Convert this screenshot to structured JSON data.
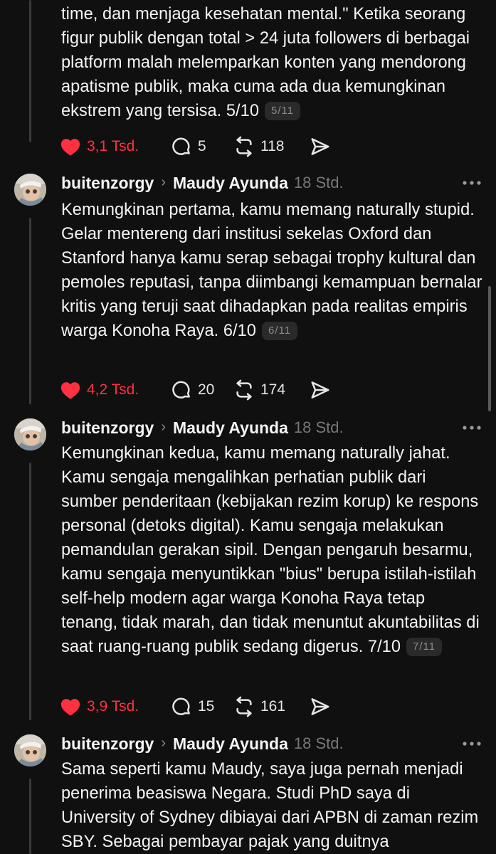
{
  "posts": [
    {
      "text": "time, dan menjaga kesehatan mental.\" Ketika seorang figur publik dengan total > 24 juta followers di berbagai platform malah melemparkan konten yang mendorong apatisme publik, maka cuma ada dua kemungkinan ekstrem yang tersisa. 5/10",
      "badge": "5/11",
      "likes": "3,1 Tsd.",
      "replies": "5",
      "reposts": "118"
    },
    {
      "username": "buitenzorgy",
      "target": "Maudy Ayunda",
      "time": "18 Std.",
      "text": "Kemungkinan pertama, kamu memang naturally stupid. Gelar mentereng dari institusi sekelas Oxford dan Stanford hanya kamu serap sebagai trophy kultural dan pemoles reputasi, tanpa diimbangi kemampuan bernalar kritis yang teruji saat dihadapkan pada realitas empiris warga Konoha Raya. 6/10",
      "badge": "6/11",
      "likes": "4,2 Tsd.",
      "replies": "20",
      "reposts": "174"
    },
    {
      "username": "buitenzorgy",
      "target": "Maudy Ayunda",
      "time": "18 Std.",
      "text": "Kemungkinan kedua, kamu memang naturally jahat. Kamu sengaja mengalihkan perhatian publik dari sumber penderitaan (kebijakan rezim korup) ke respons personal (detoks digital). Kamu sengaja melakukan pemandulan gerakan sipil. Dengan pengaruh besarmu, kamu sengaja menyuntikkan \"bius\" berupa istilah-istilah self-help modern agar warga Konoha Raya tetap tenang, tidak marah, dan tidak menuntut akuntabilitas di saat ruang-ruang publik sedang digerus. 7/10",
      "badge": "7/11",
      "likes": "3,9 Tsd.",
      "replies": "15",
      "reposts": "161"
    },
    {
      "username": "buitenzorgy",
      "target": "Maudy Ayunda",
      "time": "18 Std.",
      "text": "Sama seperti kamu Maudy, saya juga pernah menjadi penerima beasiswa Negara. Studi PhD saya di University of Sydney dibiayai dari APBN di zaman rezim SBY. Sebagai pembayar pajak yang duitnya"
    }
  ],
  "icons": {
    "like": "heart-filled-icon",
    "reply": "comment-bubble-icon",
    "repost": "repost-arrows-icon",
    "share": "send-paper-plane-icon",
    "more": "more-dots-icon"
  },
  "colors": {
    "background": "#101010",
    "text": "#f3f5f7",
    "muted": "#777777",
    "like": "#ff3040"
  }
}
